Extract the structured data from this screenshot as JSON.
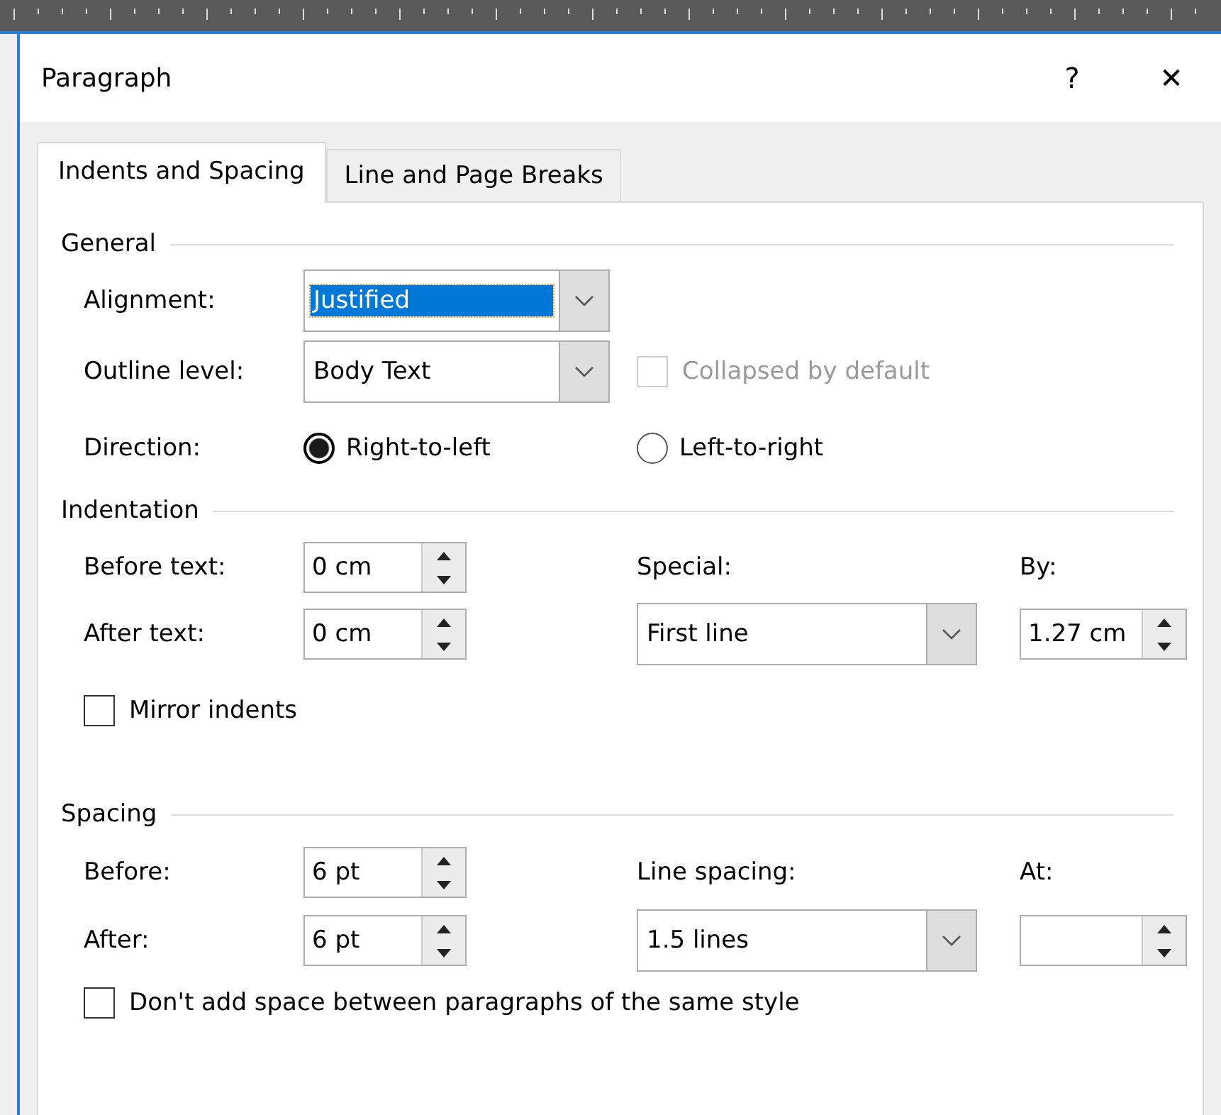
{
  "window": {
    "title": "Paragraph",
    "help": "?",
    "close": "✕"
  },
  "tabs": [
    {
      "label": "Indents and Spacing",
      "selected": true
    },
    {
      "label": "Line and Page Breaks",
      "selected": false
    }
  ],
  "general": {
    "heading": "General",
    "alignment": {
      "label": "Alignment:",
      "value": "Justified",
      "focused": true
    },
    "outline_level": {
      "label": "Outline level:",
      "value": "Body Text",
      "focused": false
    },
    "collapsed": {
      "label": "Collapsed by default",
      "checked": false,
      "disabled": true
    },
    "direction": {
      "label": "Direction:",
      "options": [
        {
          "label": "Right-to-left",
          "selected": true
        },
        {
          "label": "Left-to-right",
          "selected": false
        }
      ]
    }
  },
  "indentation": {
    "heading": "Indentation",
    "before_text": {
      "label": "Before text:",
      "value": "0 cm"
    },
    "after_text": {
      "label": "After text:",
      "value": "0 cm"
    },
    "special": {
      "label": "Special:",
      "value": "First line"
    },
    "by": {
      "label": "By:",
      "value": "1.27 cm"
    },
    "mirror": {
      "label": "Mirror indents",
      "checked": false
    }
  },
  "spacing": {
    "heading": "Spacing",
    "before": {
      "label": "Before:",
      "value": "6 pt"
    },
    "after": {
      "label": "After:",
      "value": "6 pt"
    },
    "line_spacing": {
      "label": "Line spacing:",
      "value": "1.5 lines"
    },
    "at": {
      "label": "At:"
    },
    "no_space": {
      "label": "Don't add space between paragraphs of the same style",
      "checked": false
    }
  }
}
